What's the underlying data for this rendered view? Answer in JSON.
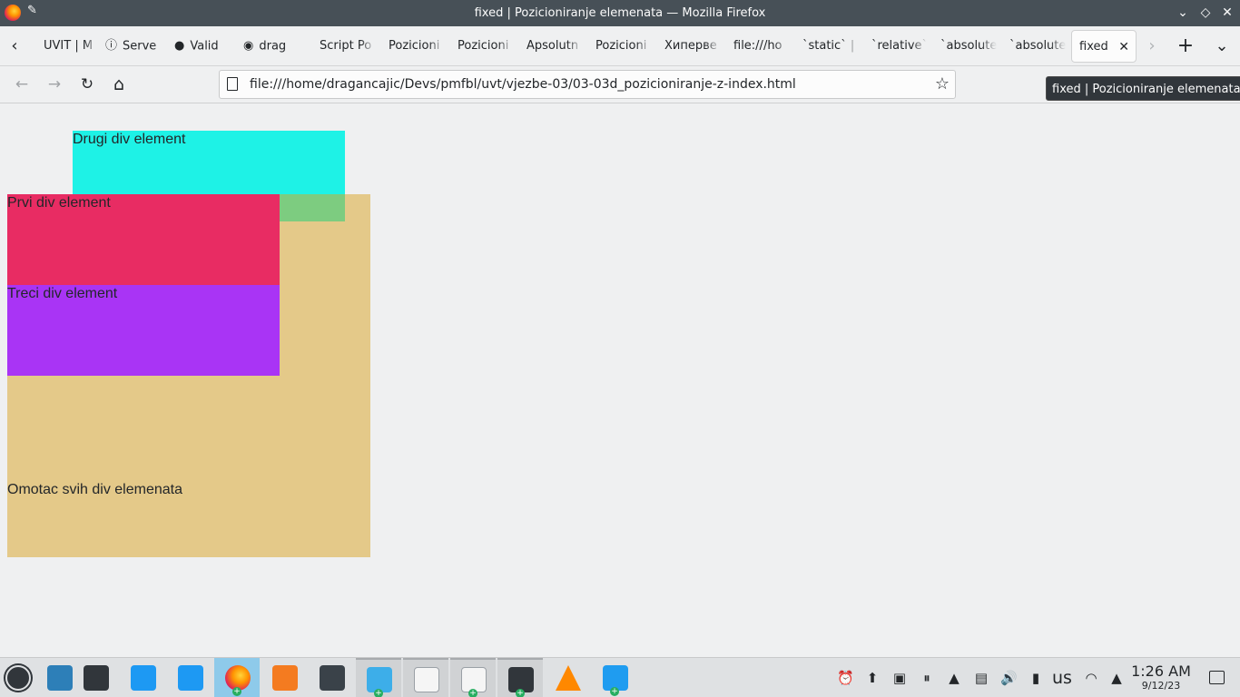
{
  "window": {
    "title": "fixed | Pozicioniranje elemenata — Mozilla Firefox",
    "pin_glyph": "✎",
    "min_glyph": "⌄",
    "max_glyph": "◇",
    "close_glyph": "✕"
  },
  "tabs": [
    {
      "label": "UVIT | M",
      "icon": ""
    },
    {
      "label": "Serve",
      "icon": "info-icon",
      "glyph": "ⓘ"
    },
    {
      "label": "Valid",
      "icon": "validator-icon",
      "glyph": "●"
    },
    {
      "label": "drag",
      "icon": "github-icon",
      "glyph": "◉"
    },
    {
      "label": "Script Po",
      "icon": ""
    },
    {
      "label": "Pozicioni",
      "icon": ""
    },
    {
      "label": "Pozicioni",
      "icon": ""
    },
    {
      "label": "Apsolutn",
      "icon": ""
    },
    {
      "label": "Pozicioni",
      "icon": ""
    },
    {
      "label": "Хиперве",
      "icon": ""
    },
    {
      "label": "file:///ho",
      "icon": ""
    },
    {
      "label": "`static` |",
      "icon": ""
    },
    {
      "label": "`relative`",
      "icon": ""
    },
    {
      "label": "`absolute",
      "icon": ""
    },
    {
      "label": "`absolute",
      "icon": ""
    }
  ],
  "active_tab": {
    "label": "fixed",
    "close_glyph": "✕"
  },
  "tabbar": {
    "scroll_left": "‹",
    "scroll_right": "›",
    "new_tab": "+",
    "list_tabs": "⌄"
  },
  "nav": {
    "back": "←",
    "forward": "→",
    "reload": "↻",
    "home": "⌂",
    "url": "file:///home/dragancajic/Devs/pmfbl/uvt/vjezbe-03/03-03d_pozicioniranje-z-index.html",
    "bookmark": "☆"
  },
  "tooltip": "fixed | Pozicioniranje elemenata",
  "page": {
    "drugi": "Drugi div element",
    "prvi": "Prvi div element",
    "treci": "Treci div element",
    "omotac": "Omotac svih div elemenata",
    "colors": {
      "omotac": "#e4c989",
      "drugi": "#1ef2e6",
      "prvi": "#e82c63",
      "treci": "#a934f5"
    }
  },
  "taskbar": {
    "apps": [
      {
        "name": "desktop-pager",
        "color": "#2d7fb8"
      },
      {
        "name": "system-settings",
        "color": "#31363b"
      },
      {
        "name": "discover",
        "color": "#1d99f3"
      },
      {
        "name": "dolphin",
        "color": "#1d99f3"
      },
      {
        "name": "firefox",
        "color": "#ff7139"
      },
      {
        "name": "pdf-reader",
        "color": "#f47b20"
      },
      {
        "name": "screenshot",
        "color": "#3a4249"
      },
      {
        "name": "file-manager",
        "color": "#3daee9"
      },
      {
        "name": "text-editor",
        "color": "#f5f5f5"
      },
      {
        "name": "document-viewer",
        "color": "#f5f5f5"
      },
      {
        "name": "konsole",
        "color": "#31363b"
      },
      {
        "name": "vlc",
        "color": "#ff8800"
      },
      {
        "name": "vscode",
        "color": "#1f9cf0"
      }
    ],
    "keyboard_layout": "us",
    "time": "1:26 AM",
    "date": "9/12/23"
  }
}
